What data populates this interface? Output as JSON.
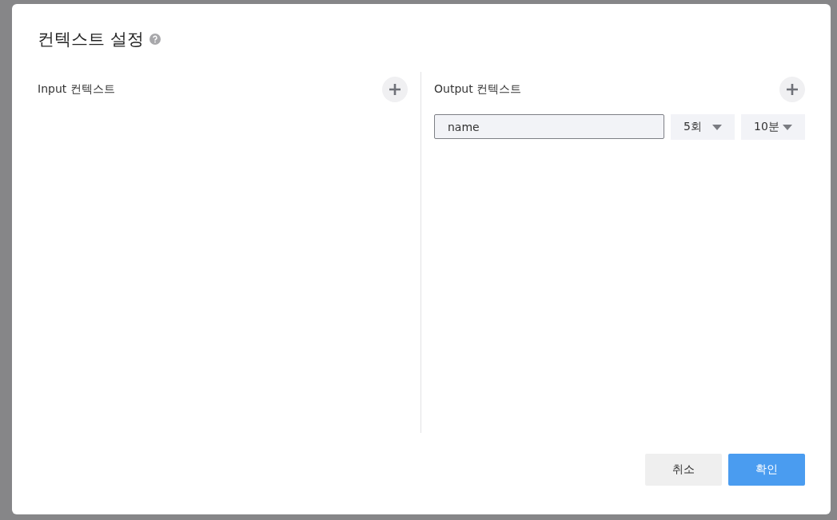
{
  "dialog": {
    "title": "컨텍스트 설정",
    "panels": [
      {
        "label": "Input 컨텍스트"
      },
      {
        "label": "Output 컨텍스트",
        "rows": [
          {
            "value": "name",
            "count": "5회",
            "interval": "10분"
          }
        ]
      }
    ],
    "buttons": [
      {
        "label": "취소",
        "kind": "secondary"
      },
      {
        "label": "확인",
        "kind": "primary"
      }
    ]
  }
}
